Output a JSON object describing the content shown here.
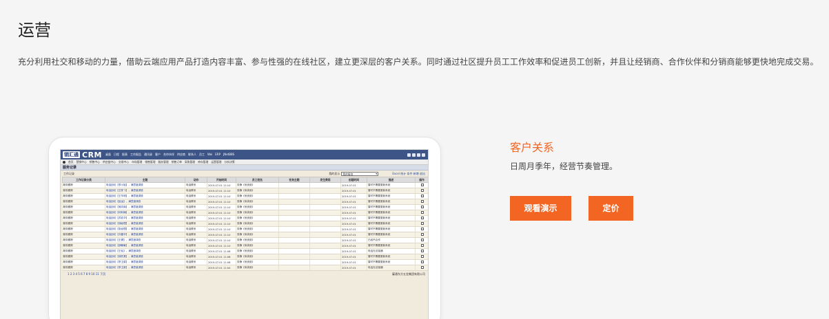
{
  "page": {
    "title": "运营",
    "description": "充分利用社交和移动的力量，借助云端应用产品打造内容丰富、参与性强的在线社区，建立更深层的客户关系。同时通过社区提升员工工作效率和促进员工创新，并且让经销商、合作伙伴和分销商能够更快地完成交易。"
  },
  "feature": {
    "title": "客户关系",
    "description": "日周月季年，经营节奏管理。",
    "demo_button": "观看演示",
    "pricing_button": "定价"
  },
  "crm": {
    "logo": "销汇通",
    "logo_text": "CRM",
    "top_nav": [
      "桌面",
      "日程",
      "报表",
      "工作报告",
      "通讯录",
      "客户",
      "合作伙伴",
      "供应商",
      "联系人",
      "员工",
      "Wei",
      "ERP",
      "JNetBBS"
    ],
    "menu": [
      "首页",
      "营销中心",
      "销售中心",
      "供应链中心",
      "交易中心",
      "市场管理",
      "销售管理",
      "服务管理",
      "销售订单",
      "采购管理",
      "库存管理",
      "运营管理",
      "分析决策"
    ],
    "section_title": "服务记录",
    "subtitle": "工作记录",
    "display_label": "我的显示",
    "display_value": "我的服务",
    "actions": "Excel 统计 条件 新增 退出",
    "columns": [
      "工作记录分类",
      "主题",
      "动作",
      "开始时间",
      "员工姓名",
      "任务主题",
      "发生费用",
      "创建时间",
      "描述",
      "操作"
    ],
    "rows": [
      {
        "category": "服务跟踪",
        "subject": "电话回访【李小姐】，满意度调查",
        "action": "电话联系",
        "start": "2019-07-01 11:10",
        "employee": "张静《系统用》",
        "task": "",
        "cost": "",
        "created": "2019-07-01",
        "desc": "暂时不需要更新系统"
      },
      {
        "category": "服务跟踪",
        "subject": "电话回访【王陈飞】，满意度调查",
        "action": "电话联系",
        "start": "2019-07-01 11:10",
        "employee": "张静《系统用》",
        "task": "",
        "cost": "",
        "created": "2019-07-01",
        "desc": "暂时不需要更新系统"
      },
      {
        "category": "服务跟踪",
        "subject": "电话回访【王华明】，满意度调查",
        "action": "电话联系",
        "start": "2019-07-01 11:10",
        "employee": "张静《系统用》",
        "task": "",
        "cost": "",
        "created": "2019-07-01",
        "desc": "暂时不需要更新系统"
      },
      {
        "category": "服务跟踪",
        "subject": "电话回访【赵运】，满意度调查",
        "action": "电话联系",
        "start": "2019-07-01 11:10",
        "employee": "张静《系统用》",
        "task": "",
        "cost": "",
        "created": "2019-07-01",
        "desc": "暂时不需要更新系统"
      },
      {
        "category": "服务跟踪",
        "subject": "电话回访【吴向南】，满意度调查",
        "action": "电话联系",
        "start": "2019-07-01 11:10",
        "employee": "张静《系统用》",
        "task": "",
        "cost": "",
        "created": "2019-07-01",
        "desc": "暂时不需要更新系统"
      },
      {
        "category": "服务跟踪",
        "subject": "电话回访【何利楠】，满意度调查",
        "action": "电话联系",
        "start": "2019-07-01 11:10",
        "employee": "张静《系统用》",
        "task": "",
        "cost": "",
        "created": "2019-07-01",
        "desc": "暂时不需要更新系统"
      },
      {
        "category": "服务跟踪",
        "subject": "电话回访【苏钦华】，满意度调查",
        "action": "电话联系",
        "start": "2019-07-01 11:10",
        "employee": "张静《系统用》",
        "task": "",
        "cost": "",
        "created": "2019-07-01",
        "desc": "暂时不需要更新系统"
      },
      {
        "category": "服务跟踪",
        "subject": "电话回访【胡经理】，满意度调查",
        "action": "电话联系",
        "start": "2019-07-01 11:10",
        "employee": "张静《系统用》",
        "task": "",
        "cost": "",
        "created": "2019-07-01",
        "desc": "暂时不需要更新系统"
      },
      {
        "category": "服务跟踪",
        "subject": "电话回访【张经理】，满意度调查",
        "action": "电话联系",
        "start": "2019-07-01 11:10",
        "employee": "张静《系统用》",
        "task": "",
        "cost": "",
        "created": "2019-07-01",
        "desc": "暂时不需要更新系统"
      },
      {
        "category": "服务跟踪",
        "subject": "电话回访【刘建华】，满意度调查",
        "action": "电话联系",
        "start": "2019-07-01 11:10",
        "employee": "张静《系统用》",
        "task": "",
        "cost": "",
        "created": "2019-07-01",
        "desc": "暂时不需要更新系统"
      },
      {
        "category": "服务跟踪",
        "subject": "电话回访【王健】，满意度调查",
        "action": "电话联系",
        "start": "2019-07-01 11:10",
        "employee": "张静《系统用》",
        "task": "",
        "cost": "",
        "created": "2019-07-01",
        "desc": "已经不合作"
      },
      {
        "category": "服务跟踪",
        "subject": "电话回访【邵敏敏】，满意度调查",
        "action": "电话联系",
        "start": "2019-07-01 11:10",
        "employee": "张静《系统用》",
        "task": "",
        "cost": "",
        "created": "2019-07-01",
        "desc": "暂时不需要更新系统"
      },
      {
        "category": "服务跟踪",
        "subject": "电话回访【王仙】，满意度调查",
        "action": "电话联系",
        "start": "2019-07-01 11:08",
        "employee": "张静《系统用》",
        "task": "",
        "cost": "",
        "created": "2019-07-01",
        "desc": "电话无法接通"
      },
      {
        "category": "服务跟踪",
        "subject": "电话回访【胡先昊】，满意度调查",
        "action": "电话联系",
        "start": "2019-07-01 11:08",
        "employee": "张静《系统用》",
        "task": "",
        "cost": "",
        "created": "2019-07-01",
        "desc": "暂时不需要更新系统"
      },
      {
        "category": "服务跟踪",
        "subject": "电话回访【李卫梁】，满意度调查",
        "action": "电话联系",
        "start": "2019-07-01 11:08",
        "employee": "张静《系统用》",
        "task": "",
        "cost": "",
        "created": "2019-07-01",
        "desc": "暂时不需要更新系统"
      },
      {
        "category": "服务跟踪",
        "subject": "电话回访【李卫梁】，满意度调查",
        "action": "电话联系",
        "start": "2019-07-01 11:04",
        "employee": "张静《系统用》",
        "task": "",
        "cost": "",
        "created": "2019-07-01",
        "desc": "电话无法接通"
      }
    ],
    "pager": "1 2 3 4 5 6 7 8 9 10 11 下页",
    "company": "蔓通东方五金集团有限公司"
  }
}
